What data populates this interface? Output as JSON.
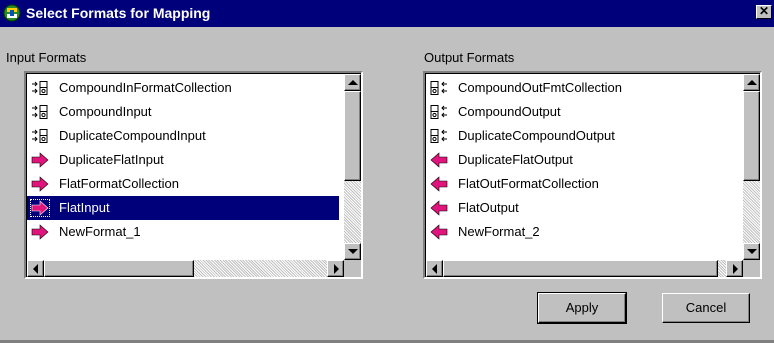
{
  "window": {
    "title": "Select Formats for Mapping",
    "close_glyph": "✕",
    "title_icon": "formats-app-icon"
  },
  "input_formats": {
    "label": "Input Formats",
    "items": [
      {
        "label": "CompoundInFormatCollection",
        "icon": "compound-format-icon",
        "selected": false
      },
      {
        "label": "CompoundInput",
        "icon": "compound-format-icon",
        "selected": false
      },
      {
        "label": "DuplicateCompoundInput",
        "icon": "compound-format-icon",
        "selected": false
      },
      {
        "label": "DuplicateFlatInput",
        "icon": "flat-input-arrow-icon",
        "selected": false
      },
      {
        "label": "FlatFormatCollection",
        "icon": "flat-input-arrow-icon",
        "selected": false
      },
      {
        "label": "FlatInput",
        "icon": "flat-input-arrow-icon",
        "selected": true
      },
      {
        "label": "NewFormat_1",
        "icon": "flat-input-arrow-icon",
        "selected": false
      }
    ]
  },
  "output_formats": {
    "label": "Output Formats",
    "items": [
      {
        "label": "CompoundOutFmtCollection",
        "icon": "compound-output-icon",
        "selected": false
      },
      {
        "label": "CompoundOutput",
        "icon": "compound-output-icon",
        "selected": false
      },
      {
        "label": "DuplicateCompoundOutput",
        "icon": "compound-output-icon",
        "selected": false
      },
      {
        "label": "DuplicateFlatOutput",
        "icon": "flat-output-arrow-icon",
        "selected": false
      },
      {
        "label": "FlatOutFormatCollection",
        "icon": "flat-output-arrow-icon",
        "selected": false
      },
      {
        "label": "FlatOutput",
        "icon": "flat-output-arrow-icon",
        "selected": false
      },
      {
        "label": "NewFormat_2",
        "icon": "flat-output-arrow-icon",
        "selected": false
      }
    ]
  },
  "buttons": {
    "apply": "Apply",
    "cancel": "Cancel"
  },
  "colors": {
    "title_bar": "#00007b",
    "selection": "#00007b",
    "arrow": "#e0147a",
    "dialog_bg": "#c0c0c0"
  }
}
